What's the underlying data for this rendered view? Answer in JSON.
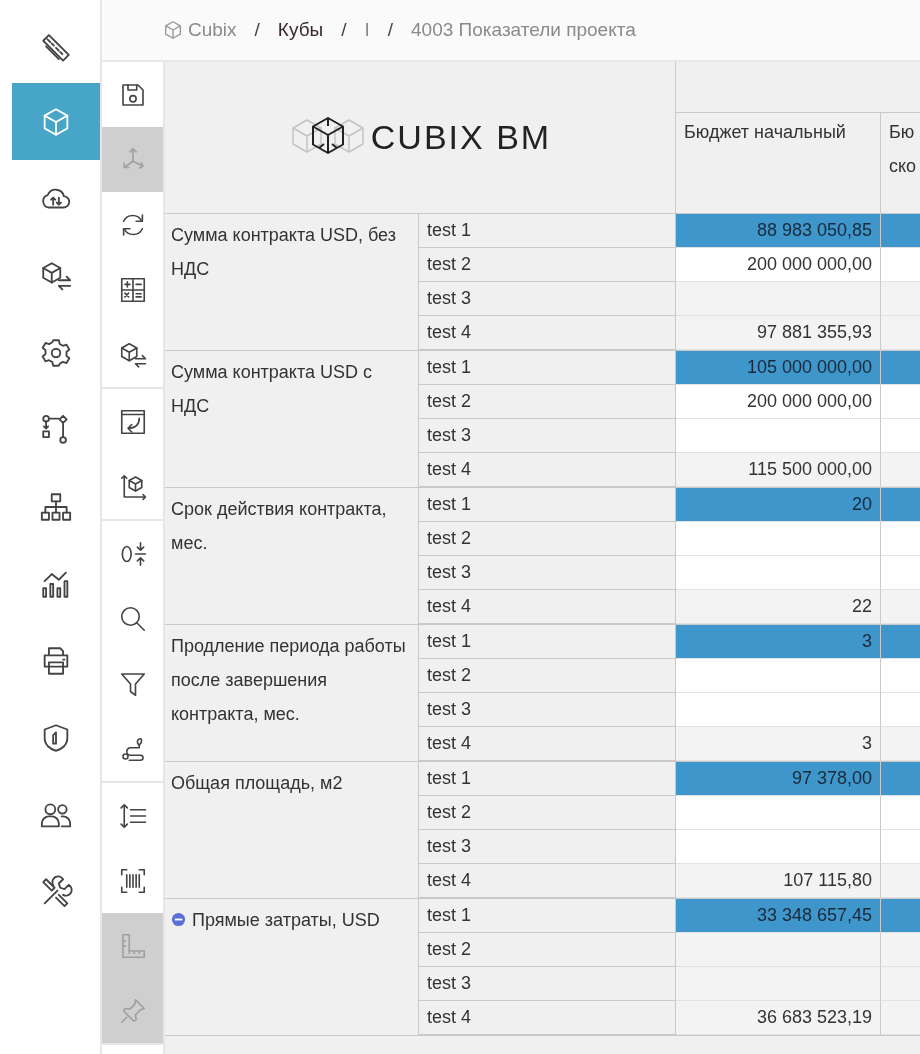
{
  "sidebar": {
    "items": [
      {
        "kind": "ruler",
        "selected": false
      },
      {
        "kind": "cube",
        "selected": true
      },
      {
        "kind": "cloud",
        "selected": false
      },
      {
        "kind": "cubeswap",
        "selected": false
      },
      {
        "kind": "gear",
        "selected": false
      },
      {
        "kind": "flow",
        "selected": false
      },
      {
        "kind": "hierarchy",
        "selected": false
      },
      {
        "kind": "chart",
        "selected": false
      },
      {
        "kind": "printer",
        "selected": false
      },
      {
        "kind": "shield",
        "selected": false
      },
      {
        "kind": "users",
        "selected": false
      },
      {
        "kind": "tools",
        "selected": false
      }
    ]
  },
  "breadcrumb": [
    {
      "label": "Cubix",
      "kind": "root"
    },
    {
      "label": "Кубы",
      "kind": "link"
    },
    {
      "label": "I",
      "kind": "plain"
    },
    {
      "label": "4003 Показатели проекта",
      "kind": "plain"
    }
  ],
  "breadcrumb_separator": "/",
  "toolbar": {
    "groups": [
      [
        {
          "kind": "save",
          "disabled": false
        },
        {
          "kind": "axes",
          "disabled": true
        },
        {
          "kind": "refresh",
          "disabled": false
        },
        {
          "kind": "calc",
          "disabled": false
        },
        {
          "kind": "cubeswap",
          "disabled": false
        }
      ],
      [
        {
          "kind": "window",
          "disabled": false
        },
        {
          "kind": "cubeaxis",
          "disabled": false
        }
      ],
      [
        {
          "kind": "zero",
          "disabled": false
        },
        {
          "kind": "search",
          "disabled": false
        },
        {
          "kind": "filter",
          "disabled": false
        },
        {
          "kind": "route",
          "disabled": false
        }
      ],
      [
        {
          "kind": "spacing",
          "disabled": false
        },
        {
          "kind": "barcode",
          "disabled": false
        },
        {
          "kind": "setsquare",
          "disabled": true
        },
        {
          "kind": "pin",
          "disabled": true
        }
      ]
    ]
  },
  "logo": {
    "text": "CUBIX BM"
  },
  "table": {
    "columns": [
      "Бюджет начальный",
      "Бю ско"
    ],
    "groups": [
      {
        "label": "Сумма контракта USD, без НДС",
        "rows": [
          {
            "name": "test 1",
            "value": "88 983 050,85",
            "highlighted": true,
            "editable": true
          },
          {
            "name": "test 2",
            "value": "200 000 000,00",
            "highlighted": false,
            "editable": true
          },
          {
            "name": "test 3",
            "value": "",
            "highlighted": false,
            "editable": false
          },
          {
            "name": "test 4",
            "value": "97 881 355,93",
            "highlighted": false,
            "editable": false
          }
        ]
      },
      {
        "label": "Сумма контракта USD с НДС",
        "rows": [
          {
            "name": "test 1",
            "value": "105 000 000,00",
            "highlighted": true,
            "editable": true
          },
          {
            "name": "test 2",
            "value": "200 000 000,00",
            "highlighted": false,
            "editable": true
          },
          {
            "name": "test 3",
            "value": "",
            "highlighted": false,
            "editable": true
          },
          {
            "name": "test 4",
            "value": "115 500 000,00",
            "highlighted": false,
            "editable": false
          }
        ]
      },
      {
        "label": "Срок действия контракта, мес.",
        "rows": [
          {
            "name": "test 1",
            "value": "20",
            "highlighted": true,
            "editable": true
          },
          {
            "name": "test 2",
            "value": "",
            "highlighted": false,
            "editable": true
          },
          {
            "name": "test 3",
            "value": "",
            "highlighted": false,
            "editable": true
          },
          {
            "name": "test 4",
            "value": "22",
            "highlighted": false,
            "editable": false
          }
        ]
      },
      {
        "label": "Продление периода работы после завершения контракта, мес.",
        "rows": [
          {
            "name": "test 1",
            "value": "3",
            "highlighted": true,
            "editable": true
          },
          {
            "name": "test 2",
            "value": "",
            "highlighted": false,
            "editable": true
          },
          {
            "name": "test 3",
            "value": "",
            "highlighted": false,
            "editable": true
          },
          {
            "name": "test 4",
            "value": "3",
            "highlighted": false,
            "editable": false
          }
        ]
      },
      {
        "label": "Общая площадь, м2",
        "rows": [
          {
            "name": "test 1",
            "value": "97 378,00",
            "highlighted": true,
            "editable": true
          },
          {
            "name": "test 2",
            "value": "",
            "highlighted": false,
            "editable": true
          },
          {
            "name": "test 3",
            "value": "",
            "highlighted": false,
            "editable": true
          },
          {
            "name": "test 4",
            "value": "107 115,80",
            "highlighted": false,
            "editable": false
          }
        ]
      },
      {
        "label": "Прямые затраты, USD",
        "expanded": true,
        "rows": [
          {
            "name": "test 1",
            "value": "33 348 657,45",
            "highlighted": true,
            "editable": true
          },
          {
            "name": "test 2",
            "value": "",
            "highlighted": false,
            "editable": false
          },
          {
            "name": "test 3",
            "value": "",
            "highlighted": false,
            "editable": false
          },
          {
            "name": "test 4",
            "value": "36 683 523,19",
            "highlighted": false,
            "editable": false
          }
        ]
      }
    ]
  }
}
